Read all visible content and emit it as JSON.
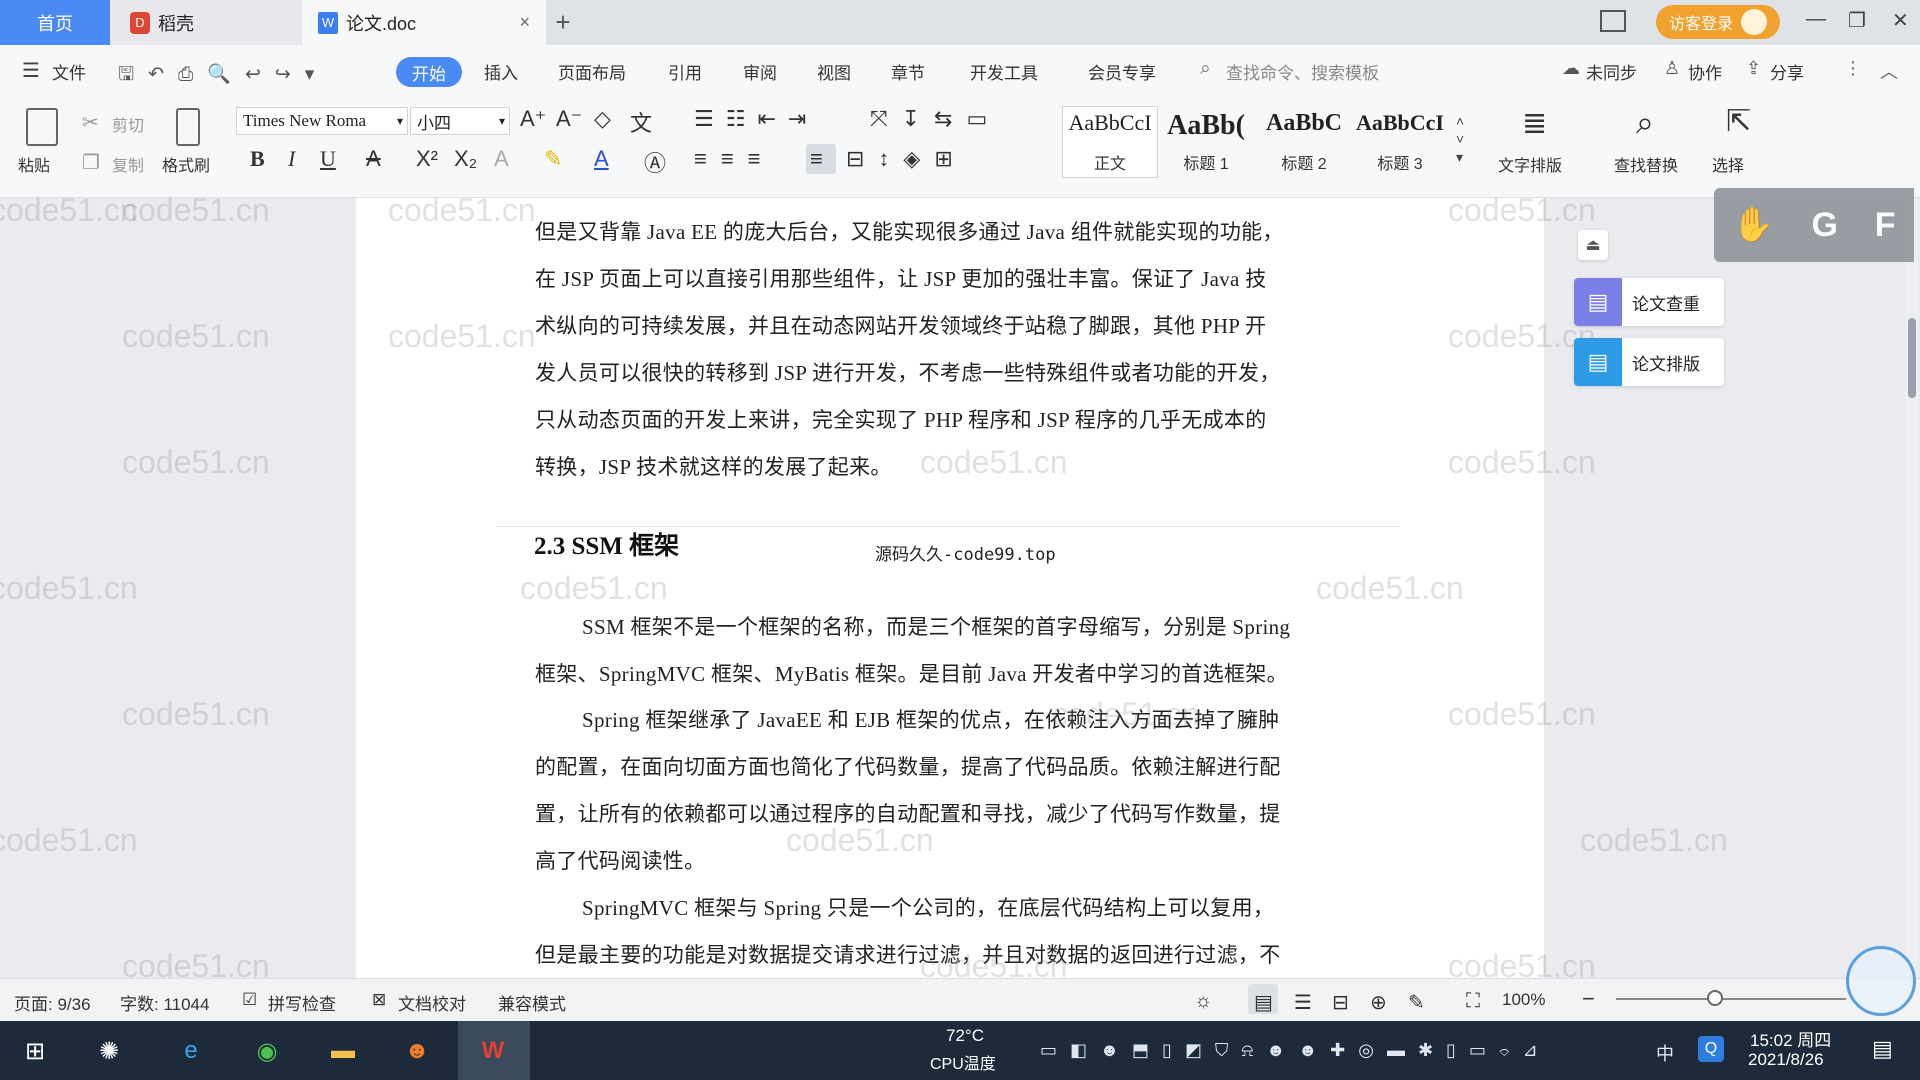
{
  "tabs": {
    "home": "首页",
    "daoke": "稻壳",
    "doc": "论文.doc",
    "add": "+",
    "close": "×"
  },
  "titlebar": {
    "login": "访客登录",
    "minimize": "—",
    "restore": "❐",
    "close": "✕"
  },
  "menu": {
    "file": "文件",
    "items": [
      "开始",
      "插入",
      "页面布局",
      "引用",
      "审阅",
      "视图",
      "章节",
      "开发工具",
      "会员专享"
    ],
    "search_placeholder": "查找命令、搜索模板",
    "unsynced": "未同步",
    "collab": "协作",
    "share": "分享"
  },
  "ribbon": {
    "paste": "粘贴",
    "cut": "剪切",
    "copy": "复制",
    "format_painter": "格式刷",
    "font_name": "Times New Roma",
    "font_size": "小四",
    "styles": [
      {
        "sample": "AaBbCcI",
        "name": "正文"
      },
      {
        "sample": "AaBb(",
        "name": "标题 1"
      },
      {
        "sample": "AaBbC",
        "name": "标题 2"
      },
      {
        "sample": "AaBbCcI",
        "name": "标题 3"
      }
    ],
    "text_layout": "文字排版",
    "find_replace": "查找替换",
    "select": "选择"
  },
  "side_panel": {
    "check": "论文查重",
    "layout": "论文排版"
  },
  "document": {
    "p1": [
      "但是又背靠 Java EE 的庞大后台，又能实现很多通过 Java 组件就能实现的功能，",
      "在 JSP 页面上可以直接引用那些组件，让 JSP 更加的强壮丰富。保证了 Java 技",
      "术纵向的可持续发展，并且在动态网站开发领域终于站稳了脚跟，其他 PHP 开",
      "发人员可以很快的转移到 JSP 进行开发，不考虑一些特殊组件或者功能的开发，",
      "只从动态页面的开发上来讲，完全实现了 PHP 程序和 JSP 程序的几乎无成本的",
      "转换，JSP 技术就这样的发展了起来。"
    ],
    "heading": "2.3 SSM 框架",
    "overlay": "源码久久-code99.top",
    "p2": [
      "SSM 框架不是一个框架的名称，而是三个框架的首字母缩写，分别是 Spring",
      "框架、SpringMVC 框架、MyBatis 框架。是目前 Java 开发者中学习的首选框架。"
    ],
    "p3": [
      "Spring 框架继承了 JavaEE 和 EJB 框架的优点，在依赖注入方面去掉了臃肿",
      "的配置，在面向切面方面也简化了代码数量，提高了代码品质。依赖注解进行配",
      "置，让所有的依赖都可以通过程序的自动配置和寻找，减少了代码写作数量，提",
      "高了代码阅读性。"
    ],
    "p4": [
      "SpringMVC 框架与 Spring 只是一个公司的，在底层代码结构上可以复用，",
      "但是最主要的功能是对数据提交请求进行过滤，并且对数据的返回进行过滤，不"
    ],
    "watermark": "code51.cn"
  },
  "statusbar": {
    "page": "页面: 9/36",
    "words": "字数: 11044",
    "spell": "拼写检查",
    "proof": "文档校对",
    "compat": "兼容模式",
    "zoom": "100%"
  },
  "taskbar": {
    "temp": "72°C",
    "cpu": "CPU温度",
    "ime": "中",
    "time": "15:02 周四",
    "date": "2021/8/26"
  }
}
